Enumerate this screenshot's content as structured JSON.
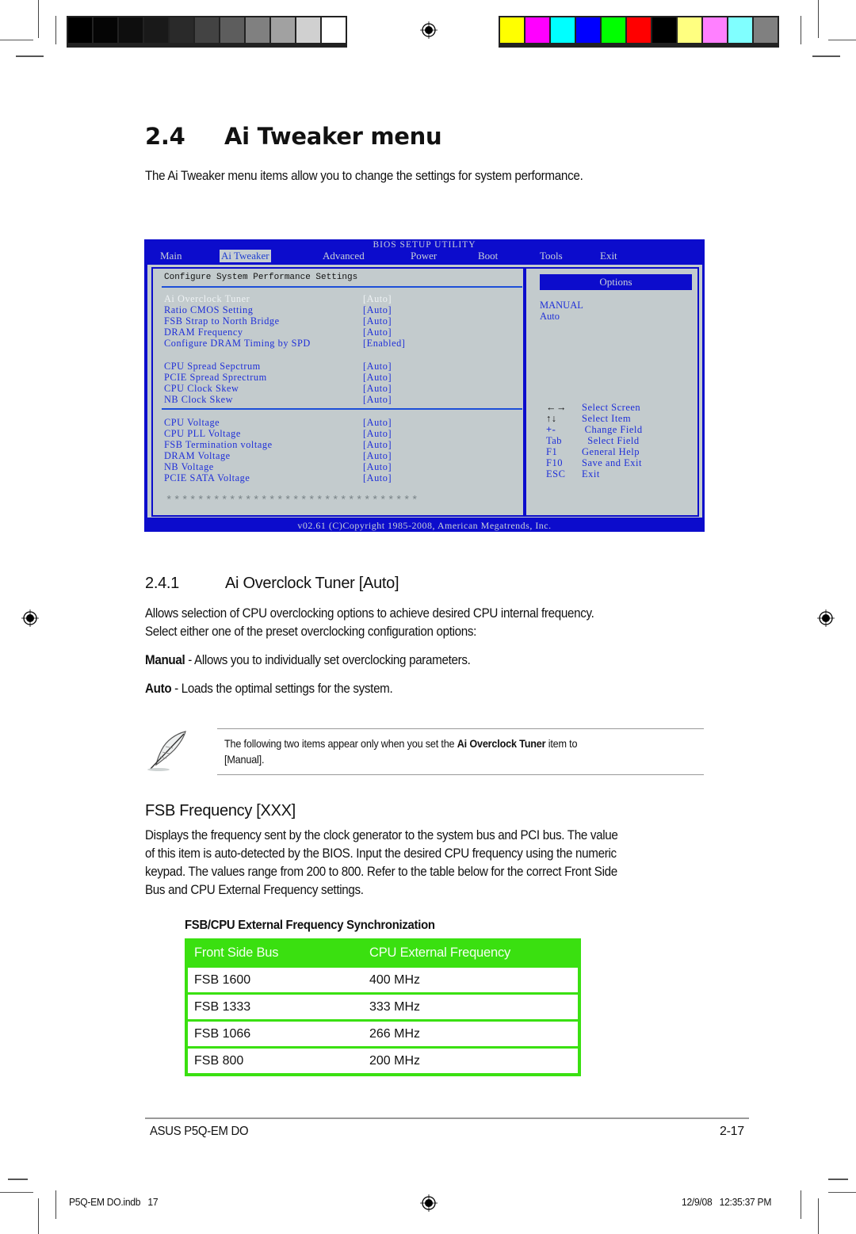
{
  "print_marks": {
    "grayscale_swatches": [
      "#000000",
      "#050505",
      "#0e0e0e",
      "#191919",
      "#2a2a2a",
      "#434343",
      "#5d5d5d",
      "#808080",
      "#a1a1a1",
      "#d0d0d0",
      "#ffffff"
    ],
    "color_swatches": [
      "#ffff00",
      "#ff00ff",
      "#00ffff",
      "#0000ff",
      "#00ff00",
      "#ff0000",
      "#000000",
      "#ffff80",
      "#ff80ff",
      "#80ffff",
      "#808080"
    ]
  },
  "section": {
    "number": "2.4",
    "title": "Ai Tweaker menu",
    "intro": "The Ai Tweaker menu items allow you to change the settings for system performance."
  },
  "bios": {
    "title": "BIOS SETUP UTILITY",
    "tabs": [
      {
        "label": "Main",
        "active": false
      },
      {
        "label": "Ai Tweaker",
        "active": true
      },
      {
        "label": "Advanced",
        "active": false
      },
      {
        "label": "Power",
        "active": false
      },
      {
        "label": "Boot",
        "active": false
      },
      {
        "label": "Tools",
        "active": false
      },
      {
        "label": "Exit",
        "active": false
      }
    ],
    "section_title": "Configure System Performance Settings",
    "items": [
      {
        "label": "Ai Overclock Tuner",
        "value": "[Auto]",
        "selected": true
      },
      {
        "label": "Ratio CMOS Setting",
        "value": "[Auto]"
      },
      {
        "label": "FSB Strap to North Bridge",
        "value": "[Auto]"
      },
      {
        "label": "DRAM Frequency",
        "value": "[Auto]"
      },
      {
        "label": "Configure DRAM Timing by SPD",
        "value": "[Enabled]"
      },
      {
        "label": "CPU Spread Sepctrum",
        "value": "[Auto]"
      },
      {
        "label": "PCIE Spread Sprectrum",
        "value": "[Auto]"
      },
      {
        "label": "CPU Clock Skew",
        "value": "[Auto]"
      },
      {
        "label": "NB Clock Skew",
        "value": "[Auto]"
      },
      {
        "label": "CPU Voltage",
        "value": "[Auto]"
      },
      {
        "label": "CPU PLL Voltage",
        "value": "[Auto]"
      },
      {
        "label": "FSB Termination voltage",
        "value": "[Auto]"
      },
      {
        "label": "DRAM Voltage",
        "value": "[Auto]"
      },
      {
        "label": "NB Voltage",
        "value": "[Auto]"
      },
      {
        "label": "PCIE SATA Voltage",
        "value": "[Auto]"
      }
    ],
    "stars": "********************************",
    "options_header": "Options",
    "options": [
      "MANUAL",
      "Auto"
    ],
    "keys": [
      {
        "key": "←→",
        "action": "Select Screen"
      },
      {
        "key": "↑↓",
        "action": "Select Item"
      },
      {
        "key": "+-",
        "action": " Change Field"
      },
      {
        "key": "Tab",
        "action": "  Select Field"
      },
      {
        "key": "F1",
        "action": "General Help"
      },
      {
        "key": "F10",
        "action": "Save and Exit"
      },
      {
        "key": "ESC",
        "action": "Exit"
      }
    ],
    "footer": "v02.61 (C)Copyright 1985-2008, American Megatrends, Inc."
  },
  "subsection": {
    "number": "2.4.1",
    "title": "Ai Overclock Tuner [Auto]",
    "para_line1": "Allows selection of CPU overclocking options to achieve desired CPU internal frequency.",
    "para_line2": "Select either one of the preset overclocking configuration options:",
    "manual_term": "Manual",
    "manual_desc": " - Allows you to individually set overclocking parameters.",
    "auto_term": "Auto",
    "auto_desc": " - Loads the optimal settings for the system."
  },
  "note": {
    "icon": "quill-pen-icon",
    "text_before": "The following two items appear only when you set the ",
    "text_bold": "Ai Overclock Tuner",
    "text_after": " item to",
    "text_line2": "[Manual]."
  },
  "fsb": {
    "title": "FSB Frequency [XXX]",
    "lines": [
      "Displays the frequency sent by the clock generator to the system bus and PCI bus. The value",
      "of this item is auto-detected by the BIOS. Input the desired CPU frequency using the numeric",
      "keypad. The values range from 200 to 800. Refer to the table below for the correct Front Side",
      "Bus and CPU External Frequency settings."
    ],
    "table_title": "FSB/CPU External Frequency Synchronization",
    "table": {
      "headers": [
        "Front Side Bus",
        "CPU External Frequency"
      ],
      "rows": [
        [
          "FSB 1600",
          "400 MHz"
        ],
        [
          "FSB 1333",
          "333 MHz"
        ],
        [
          "FSB 1066",
          "266 MHz"
        ],
        [
          "FSB 800",
          "200 MHz"
        ]
      ],
      "accent_color": "#3ae010"
    }
  },
  "footer": {
    "product": "ASUS P5Q-EM DO",
    "page": "2-17",
    "slug_file": "P5Q-EM DO.indb   17",
    "slug_timestamp": "12/9/08   12:35:37 PM"
  }
}
